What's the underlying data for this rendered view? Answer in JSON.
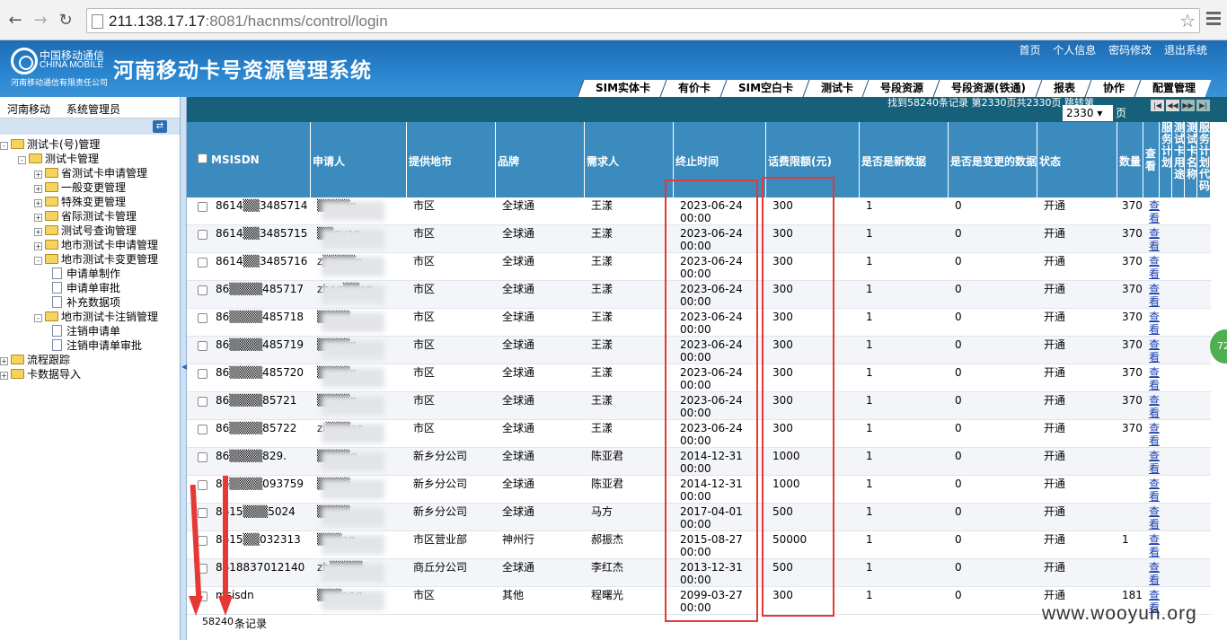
{
  "browser": {
    "url_host": "211.138.17.17",
    "url_rest": ":8081/hacnms/control/login"
  },
  "header": {
    "logo_cn": "中国移动通信",
    "logo_en": "CHINA MOBILE",
    "logo_company": "河南移动通信有限责任公司",
    "title": "河南移动卡号资源管理系统",
    "links": [
      "首页",
      "个人信息",
      "密码修改",
      "退出系统"
    ],
    "tabs": [
      "SIM实体卡",
      "有价卡",
      "SIM空白卡",
      "测试卡",
      "号段资源",
      "号段资源(铁通)",
      "报表",
      "协作",
      "配置管理"
    ]
  },
  "left": {
    "org": "河南移动",
    "role": "系统管理员",
    "tree": [
      {
        "label": "测试卡(号)管理",
        "level": 0,
        "type": "folder",
        "pm": "-"
      },
      {
        "label": "测试卡管理",
        "level": 1,
        "type": "folder",
        "pm": "-"
      },
      {
        "label": "省测试卡申请管理",
        "level": 2,
        "type": "folder",
        "pm": "+"
      },
      {
        "label": "一般变更管理",
        "level": 2,
        "type": "folder",
        "pm": "+"
      },
      {
        "label": "特殊变更管理",
        "level": 2,
        "type": "folder",
        "pm": "+"
      },
      {
        "label": "省际测试卡管理",
        "level": 2,
        "type": "folder",
        "pm": "+"
      },
      {
        "label": "测试号查询管理",
        "level": 2,
        "type": "folder",
        "pm": "+"
      },
      {
        "label": "地市测试卡申请管理",
        "level": 2,
        "type": "folder",
        "pm": "+"
      },
      {
        "label": "地市测试卡变更管理",
        "level": 2,
        "type": "folder",
        "pm": "-"
      },
      {
        "label": "申请单制作",
        "level": 3,
        "type": "doc",
        "pm": ""
      },
      {
        "label": "申请单审批",
        "level": 3,
        "type": "doc",
        "pm": ""
      },
      {
        "label": "补充数据项",
        "level": 3,
        "type": "doc",
        "pm": ""
      },
      {
        "label": "地市测试卡注销管理",
        "level": 2,
        "type": "folder",
        "pm": "-"
      },
      {
        "label": "注销申请单",
        "level": 3,
        "type": "doc",
        "pm": ""
      },
      {
        "label": "注销申请单审批",
        "level": 3,
        "type": "doc",
        "pm": ""
      },
      {
        "label": "流程跟踪",
        "level": 0,
        "type": "folder",
        "pm": "+"
      },
      {
        "label": "卡数据导入",
        "level": 0,
        "type": "folder",
        "pm": "+"
      }
    ]
  },
  "pager": {
    "info": "找到58240条记录 第2330页共2330页 跳转第",
    "page": "2330",
    "unit": "页"
  },
  "table": {
    "columns": [
      "MSISDN",
      "申请人",
      "提供地市",
      "品牌",
      "需求人",
      "终止时间",
      "话费限额(元)",
      "是否是新数据",
      "是否是变更的数据",
      "状态",
      "数量",
      "查看",
      "服务计划",
      "测试卡用途",
      "测试卡名称",
      "服务计划代码"
    ],
    "rows": [
      {
        "msisdn": "8614▒▒3485714",
        "applicant": "▒▒▒▒n",
        "city": "市区",
        "brand": "全球通",
        "requester": "王漾",
        "end": "2023-06-24 00:00",
        "limit": "300",
        "isnew": "1",
        "changed": "0",
        "status": "开通",
        "qty": "370",
        "view": "查看"
      },
      {
        "msisdn": "8614▒▒3485715",
        "applicant": "▒▒gyan",
        "city": "市区",
        "brand": "全球通",
        "requester": "王漾",
        "end": "2023-06-24 00:00",
        "limit": "300",
        "isnew": "1",
        "changed": "0",
        "status": "开通",
        "qty": "370",
        "view": "查看"
      },
      {
        "msisdn": "8614▒▒3485716",
        "applicant": "z▒▒▒▒n",
        "city": "市区",
        "brand": "全球通",
        "requester": "王漾",
        "end": "2023-06-24 00:00",
        "limit": "300",
        "isnew": "1",
        "changed": "0",
        "status": "开通",
        "qty": "370",
        "view": "查看"
      },
      {
        "msisdn": "86▒▒▒▒485717",
        "applicant": "zhag▒▒an",
        "city": "市区",
        "brand": "全球通",
        "requester": "王漾",
        "end": "2023-06-24 00:00",
        "limit": "300",
        "isnew": "1",
        "changed": "0",
        "status": "开通",
        "qty": "370",
        "view": "查看"
      },
      {
        "msisdn": "86▒▒▒▒485718",
        "applicant": "▒▒▒▒",
        "city": "市区",
        "brand": "全球通",
        "requester": "王漾",
        "end": "2023-06-24 00:00",
        "limit": "300",
        "isnew": "1",
        "changed": "0",
        "status": "开通",
        "qty": "370",
        "view": "查看"
      },
      {
        "msisdn": "86▒▒▒▒485719",
        "applicant": "▒▒▒▒n",
        "city": "市区",
        "brand": "全球通",
        "requester": "王漾",
        "end": "2023-06-24 00:00",
        "limit": "300",
        "isnew": "1",
        "changed": "0",
        "status": "开通",
        "qty": "370",
        "view": "查看"
      },
      {
        "msisdn": "86▒▒▒▒485720",
        "applicant": "▒▒▒▒n",
        "city": "市区",
        "brand": "全球通",
        "requester": "王漾",
        "end": "2023-06-24 00:00",
        "limit": "300",
        "isnew": "1",
        "changed": "0",
        "status": "开通",
        "qty": "370",
        "view": "查看"
      },
      {
        "msisdn": "86▒▒▒▒85721",
        "applicant": "▒▒▒▒n",
        "city": "市区",
        "brand": "全球通",
        "requester": "王漾",
        "end": "2023-06-24 00:00",
        "limit": "300",
        "isnew": "1",
        "changed": "0",
        "status": "开通",
        "qty": "370",
        "view": "查看"
      },
      {
        "msisdn": "86▒▒▒▒85722",
        "applicant": "zi▒▒▒an",
        "city": "市区",
        "brand": "全球通",
        "requester": "王漾",
        "end": "2023-06-24 00:00",
        "limit": "300",
        "isnew": "1",
        "changed": "0",
        "status": "开通",
        "qty": "370",
        "view": "查看"
      },
      {
        "msisdn": "86▒▒▒▒829.",
        "applicant": "▒▒▒▒g",
        "city": "新乡分公司",
        "brand": "全球通",
        "requester": "陈亚君",
        "end": "2014-12-31 00:00",
        "limit": "1000",
        "isnew": "1",
        "changed": "0",
        "status": "开通",
        "qty": "",
        "view": "查看"
      },
      {
        "msisdn": "86▒▒▒▒093759",
        "applicant": "▒▒▒▒",
        "city": "新乡分公司",
        "brand": "全球通",
        "requester": "陈亚君",
        "end": "2014-12-31 00:00",
        "limit": "1000",
        "isnew": "1",
        "changed": "0",
        "status": "开通",
        "qty": "",
        "view": "查看"
      },
      {
        "msisdn": "8615▒▒▒5024",
        "applicant": "▒▒▒▒",
        "city": "新乡分公司",
        "brand": "全球通",
        "requester": "马方",
        "end": "2017-04-01 00:00",
        "limit": "500",
        "isnew": "1",
        "changed": "0",
        "status": "开通",
        "qty": "",
        "view": "查看"
      },
      {
        "msisdn": "8615▒▒032313",
        "applicant": "▒▒▒an",
        "city": "市区营业部",
        "brand": "神州行",
        "requester": "郝振杰",
        "end": "2015-08-27 00:00",
        "limit": "50000",
        "isnew": "1",
        "changed": "0",
        "status": "开通",
        "qty": "1",
        "view": "查看"
      },
      {
        "msisdn": "8618837012140",
        "applicant": "zh▒▒▒▒",
        "city": "商丘分公司",
        "brand": "全球通",
        "requester": "李红杰",
        "end": "2013-12-31 00:00",
        "limit": "500",
        "isnew": "1",
        "changed": "0",
        "status": "开通",
        "qty": "",
        "view": "查看"
      },
      {
        "msisdn": "msisdn",
        "applicant": "▒▒▒ong",
        "city": "市区",
        "brand": "其他",
        "requester": "程曙光",
        "end": "2099-03-27 00:00",
        "limit": "300",
        "isnew": "1",
        "changed": "0",
        "status": "开通",
        "qty": "181",
        "view": "查看"
      }
    ]
  },
  "footer": {
    "count": "58240",
    "label": "条记录"
  },
  "watermark": "www.wooyun.org",
  "side_badge": "72",
  "colors": {
    "header_blue": "#2a86d0",
    "table_head": "#3b8bbf",
    "highlight_red": "#e53935"
  }
}
